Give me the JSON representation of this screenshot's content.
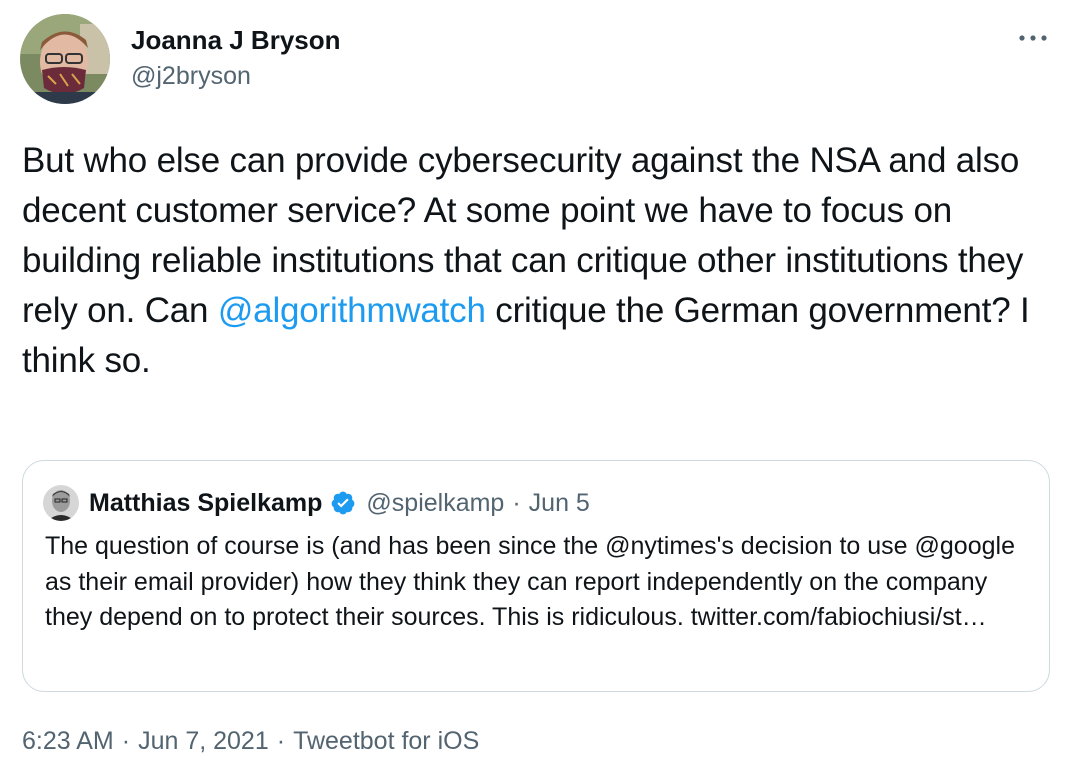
{
  "author": {
    "name": "Joanna J Bryson",
    "handle": "@j2bryson"
  },
  "tweet": {
    "text_before": "But who else can provide cybersecurity against the NSA and also decent customer service? At some point we have to focus on building reliable institutions that can critique other institutions they rely on. Can ",
    "mention": "@algorithmwatch",
    "text_after": " critique the German government? I think so."
  },
  "quoted_tweet": {
    "author_name": "Matthias Spielkamp",
    "author_handle": "@spielkamp",
    "separator": "·",
    "date": "Jun 5",
    "text": "The question of course is (and has been since the @nytimes's decision to use @google as their email provider) how they think they can report independently on the company they depend on to protect their sources. This is ridiculous. twitter.com/fabiochiusi/st…"
  },
  "meta": {
    "time": "6:23 AM",
    "separator": "·",
    "date": "Jun 7, 2021",
    "source": "Tweetbot for iOS"
  },
  "colors": {
    "link": "#1d9bf0",
    "secondary_text": "#536471",
    "verified": "#1d9bf0",
    "border": "#cfd9de"
  },
  "icons": {
    "more": "more-horizontal-icon",
    "verified": "verified-badge-icon"
  }
}
